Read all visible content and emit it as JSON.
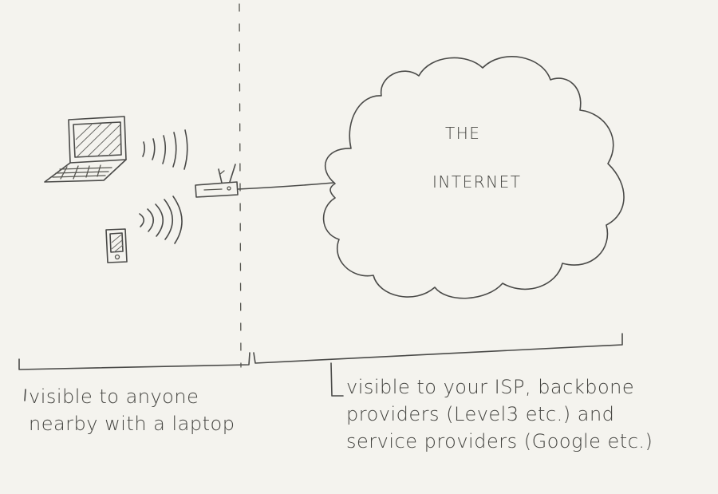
{
  "cloud": {
    "line1": "THE",
    "line2": "INTERNET"
  },
  "captions": {
    "left": "visible to anyone\nnearby with a laptop",
    "right": "visible to your ISP, backbone\nproviders (Level3 etc.) and\nservice providers (Google etc.)"
  },
  "colors": {
    "paper": "#f4f3ee",
    "ink": "#4a4a48"
  }
}
